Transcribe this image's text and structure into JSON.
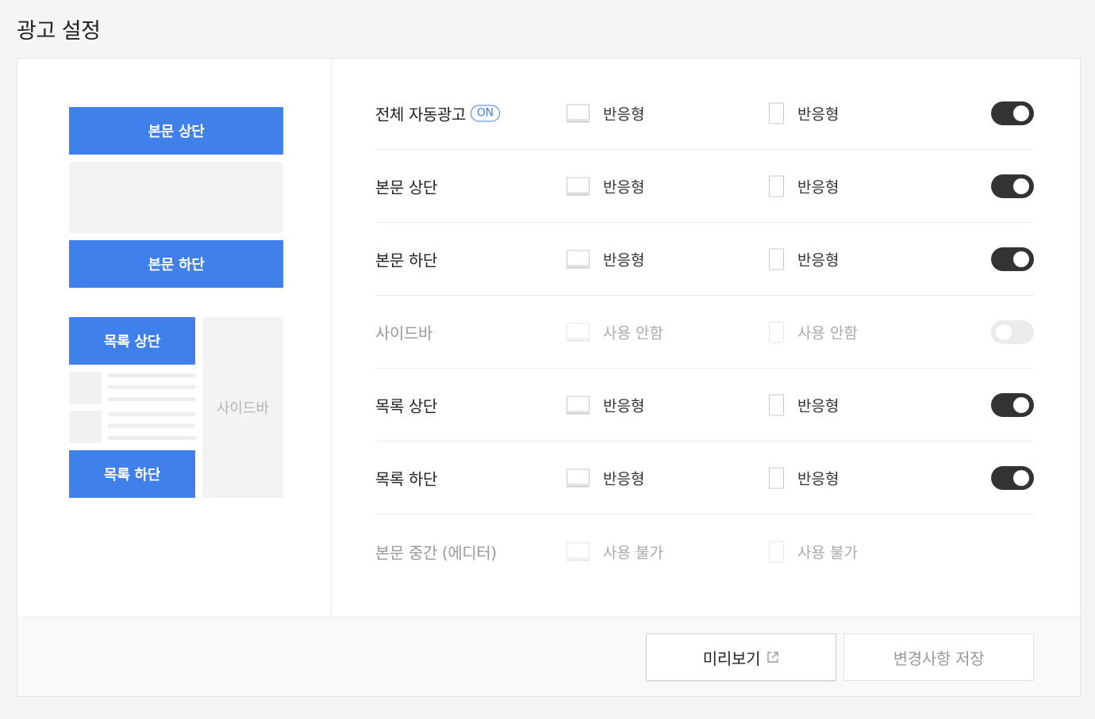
{
  "page": {
    "title": "광고 설정"
  },
  "preview": {
    "body_top": "본문 상단",
    "body_bottom": "본문 하단",
    "list_top": "목록 상단",
    "list_bottom": "목록 하단",
    "sidebar": "사이드바"
  },
  "rows": [
    {
      "label": "전체 자동광고",
      "badge": "ON",
      "pc": "반응형",
      "mobile": "반응형",
      "toggle": "on"
    },
    {
      "label": "본문 상단",
      "pc": "반응형",
      "mobile": "반응형",
      "toggle": "on"
    },
    {
      "label": "본문 하단",
      "pc": "반응형",
      "mobile": "반응형",
      "toggle": "on"
    },
    {
      "label": "사이드바",
      "pc": "사용 안함",
      "mobile": "사용 안함",
      "toggle": "off"
    },
    {
      "label": "목록 상단",
      "pc": "반응형",
      "mobile": "반응형",
      "toggle": "on"
    },
    {
      "label": "목록 하단",
      "pc": "반응형",
      "mobile": "반응형",
      "toggle": "on"
    },
    {
      "label": "본문 중간 (에디터)",
      "pc": "사용 불가",
      "mobile": "사용 불가",
      "toggle": "none"
    }
  ],
  "footer": {
    "preview_label": "미리보기",
    "save_label": "변경사항 저장"
  },
  "colors": {
    "accent": "#4080ea",
    "toggle_on": "#333333",
    "toggle_off": "#ebebeb"
  },
  "icons": {
    "pc": "monitor-icon",
    "mobile": "mobile-icon",
    "external": "external-link-icon"
  }
}
